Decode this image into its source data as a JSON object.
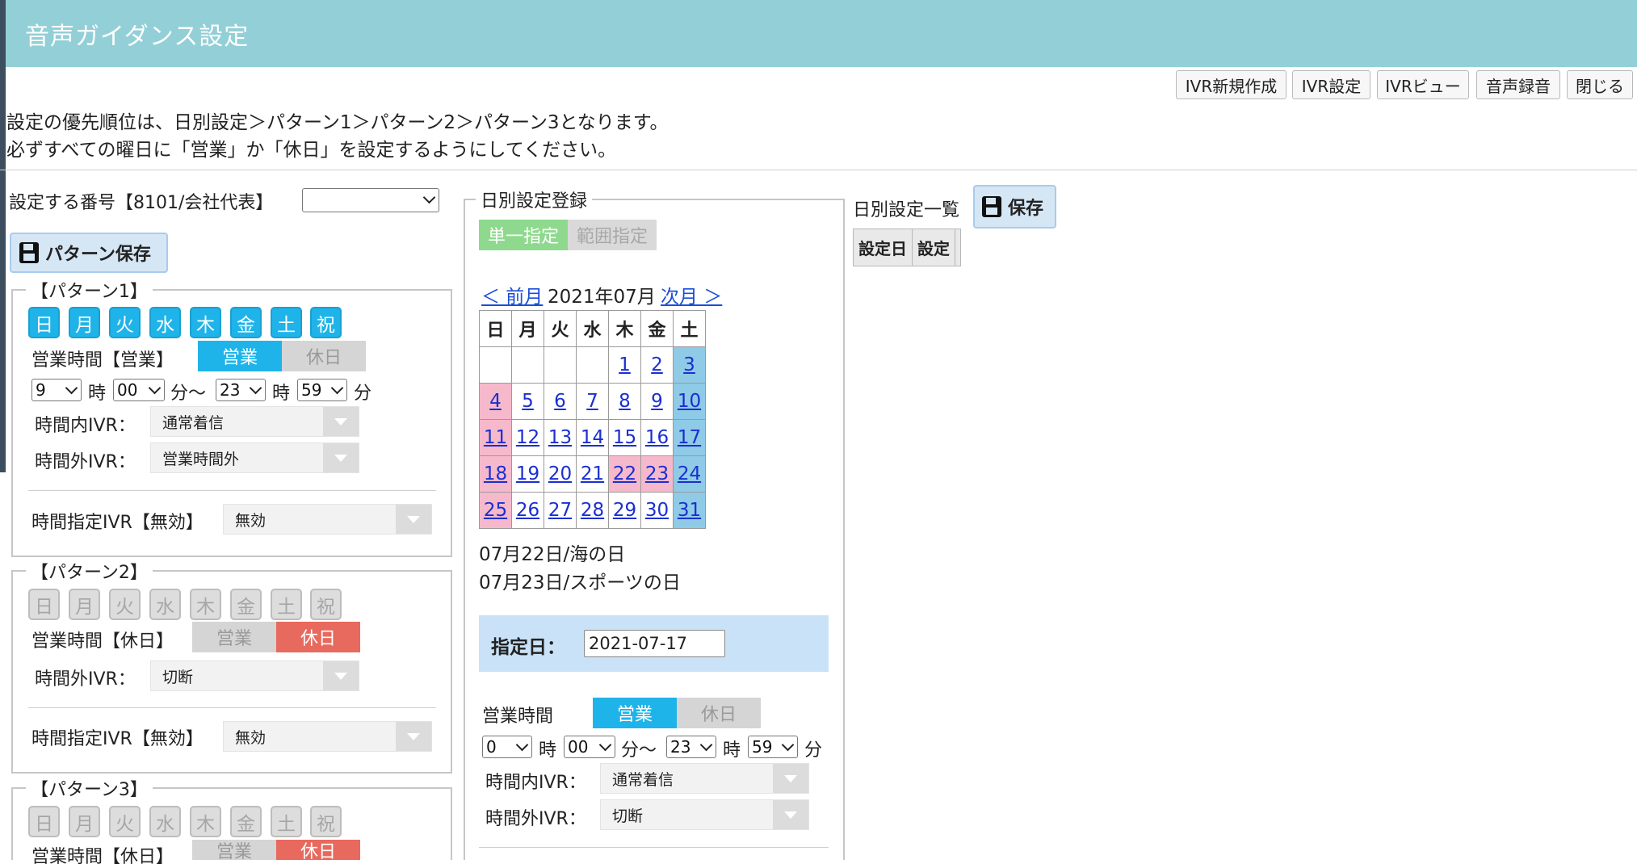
{
  "header": {
    "title": "音声ガイダンス設定"
  },
  "toolbar": {
    "buttons": [
      {
        "id": "ivr-new",
        "label": "IVR新規作成"
      },
      {
        "id": "ivr-settings",
        "label": "IVR設定"
      },
      {
        "id": "ivr-view",
        "label": "IVRビュー"
      },
      {
        "id": "voice-record",
        "label": "音声録音"
      },
      {
        "id": "close",
        "label": "閉じる"
      }
    ]
  },
  "notice": {
    "line1": "設定の優先順位は、日別設定＞パターン1＞パターン2＞パターン3となります。",
    "line2": "必ずすべての曜日に「営業」か「休日」を設定するようにしてください。"
  },
  "left": {
    "number_label": "設定する番号【8101/会社代表】",
    "number_value": "",
    "pattern_save": "パターン保存",
    "pattern1": {
      "legend": "【パターン1】",
      "days": [
        "日",
        "月",
        "火",
        "水",
        "木",
        "金",
        "土",
        "祝"
      ],
      "hours_label": "営業時間【営業】",
      "toggle_open": "営業",
      "toggle_closed": "休日",
      "start_hour": "9",
      "start_min": "00",
      "end_hour": "23",
      "end_min": "59",
      "hour_unit": "時",
      "min_unit_range": "分～",
      "min_unit": "分",
      "in_ivr_label": "時間内IVR：",
      "in_ivr_value": "通常着信",
      "out_ivr_label": "時間外IVR：",
      "out_ivr_value": "営業時間外",
      "timed_ivr_label": "時間指定IVR【無効】",
      "timed_ivr_value": "無効"
    },
    "pattern2": {
      "legend": "【パターン2】",
      "days": [
        "日",
        "月",
        "火",
        "水",
        "木",
        "金",
        "土",
        "祝"
      ],
      "hours_label": "営業時間【休日】",
      "toggle_open": "営業",
      "toggle_closed": "休日",
      "out_ivr_label": "時間外IVR：",
      "out_ivr_value": "切断",
      "timed_ivr_label": "時間指定IVR【無効】",
      "timed_ivr_value": "無効"
    },
    "pattern3": {
      "legend": "【パターン3】",
      "days": [
        "日",
        "月",
        "火",
        "水",
        "木",
        "金",
        "土",
        "祝"
      ],
      "hours_label": "営業時間【休日】",
      "toggle_open": "営業",
      "toggle_closed": "休日"
    }
  },
  "middle": {
    "legend": "日別設定登録",
    "mode_single": "単一指定",
    "mode_range": "範囲指定",
    "prev": "＜ 前月",
    "month": "2021年07月",
    "next": "次月 ＞",
    "weekdays": [
      "日",
      "月",
      "火",
      "水",
      "木",
      "金",
      "土"
    ],
    "weeks": [
      [
        "",
        "",
        "",
        "",
        "1",
        "2",
        "3"
      ],
      [
        "4",
        "5",
        "6",
        "7",
        "8",
        "9",
        "10"
      ],
      [
        "11",
        "12",
        "13",
        "14",
        "15",
        "16",
        "17"
      ],
      [
        "18",
        "19",
        "20",
        "21",
        "22",
        "23",
        "24"
      ],
      [
        "25",
        "26",
        "27",
        "28",
        "29",
        "30",
        "31"
      ]
    ],
    "holidays": [
      "07月22日/海の日",
      "07月23日/スポーツの日"
    ],
    "date_label": "指定日：",
    "date_value": "2021-07-17",
    "hours_label": "営業時間",
    "toggle_open": "営業",
    "toggle_closed": "休日",
    "start_hour": "0",
    "start_min": "00",
    "end_hour": "23",
    "end_min": "59",
    "hour_unit": "時",
    "min_unit_range": "分～",
    "min_unit": "分",
    "in_ivr_label": "時間内IVR：",
    "in_ivr_value": "通常着信",
    "out_ivr_label": "時間外IVR：",
    "out_ivr_value": "切断"
  },
  "right": {
    "title": "日別設定一覧",
    "save": "保存",
    "columns": [
      "設定日",
      "設定"
    ]
  },
  "colors": {
    "header": "#93cfd6",
    "day_on": "#1fb4e9",
    "closed": "#e8695d",
    "sunday": "#f6b9cc",
    "saturday": "#8fcae6"
  }
}
